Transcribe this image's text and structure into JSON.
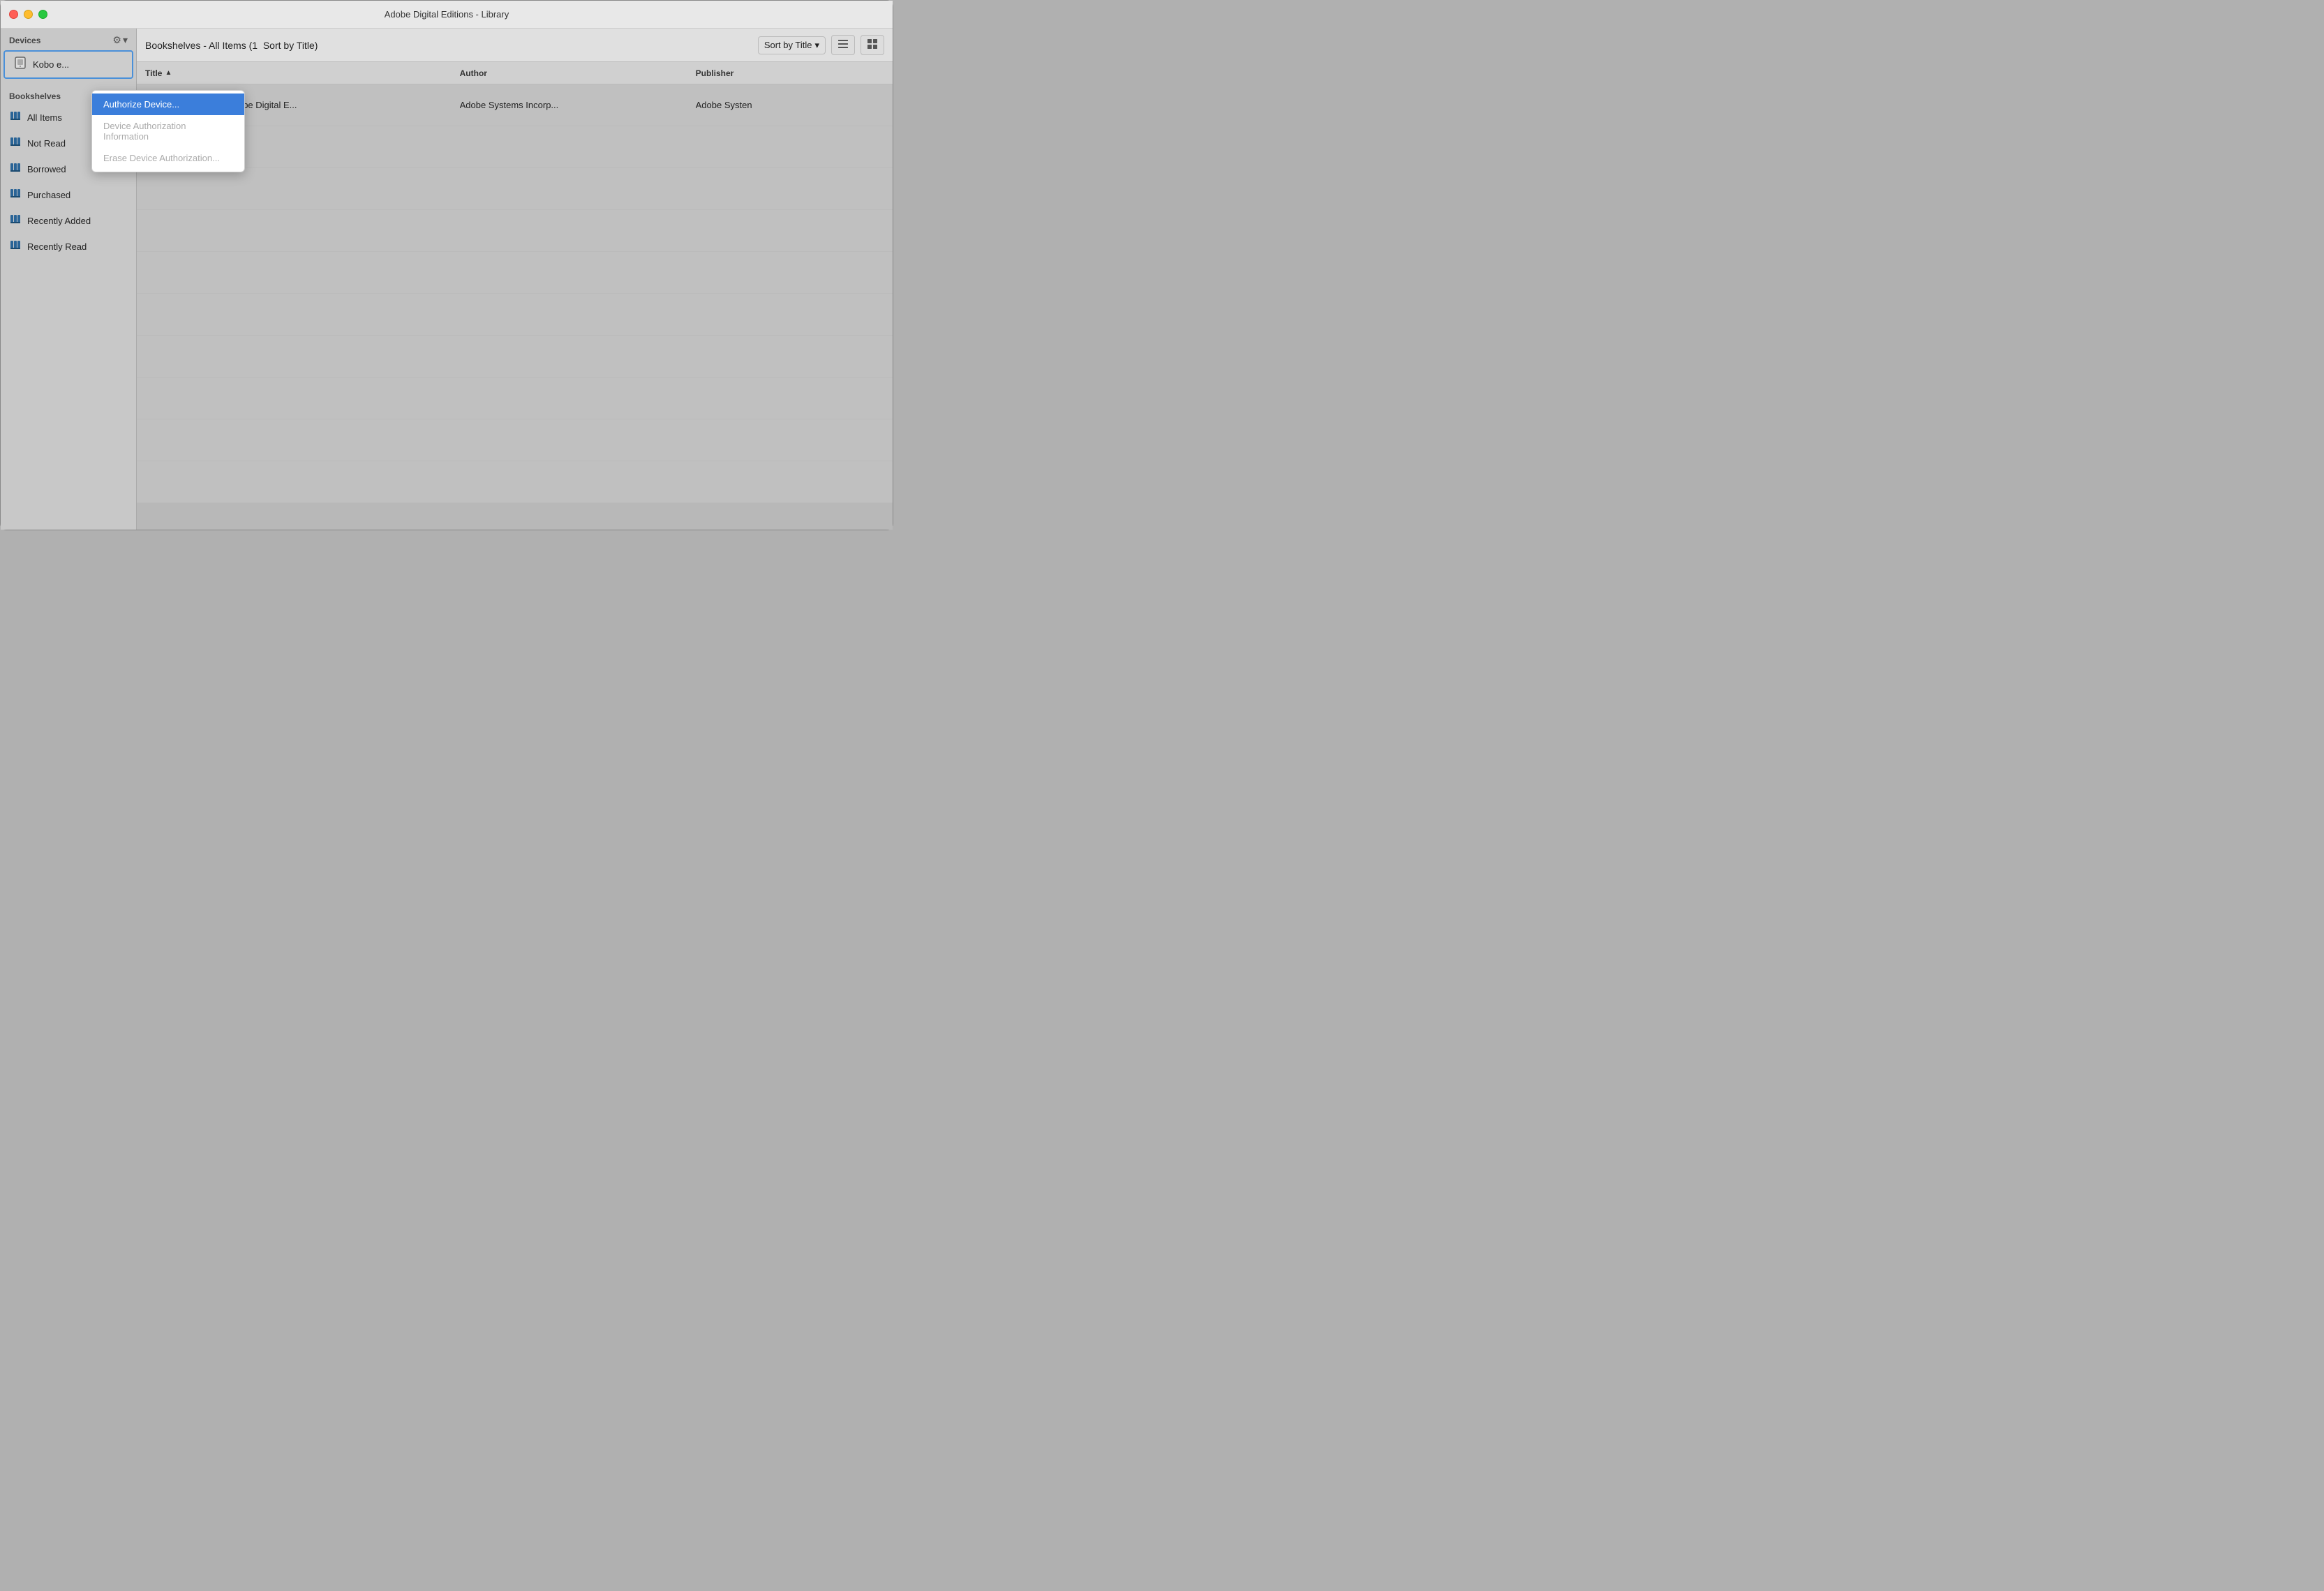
{
  "window": {
    "title": "Adobe Digital Editions - Library"
  },
  "sidebar": {
    "devices_label": "Devices",
    "gear_icon": "⚙",
    "gear_dropdown_icon": "▾",
    "device_name": "Kobo e...",
    "dropdown_menu": {
      "items": [
        {
          "id": "authorize",
          "label": "Authorize Device...",
          "state": "active"
        },
        {
          "id": "device-info",
          "label": "Device Authorization Information",
          "state": "disabled"
        },
        {
          "id": "erase",
          "label": "Erase Device Authorization...",
          "state": "disabled"
        }
      ]
    },
    "bookshelves_label": "Bookshelves",
    "add_icon": "+",
    "settings_icon": "⚙",
    "settings_dropdown_icon": "▾",
    "shelves": [
      {
        "id": "all-items",
        "label": "All Items"
      },
      {
        "id": "not-read",
        "label": "Not Read"
      },
      {
        "id": "borrowed",
        "label": "Borrowed"
      },
      {
        "id": "purchased",
        "label": "Purchased"
      },
      {
        "id": "recently-added",
        "label": "Recently Added"
      },
      {
        "id": "recently-read",
        "label": "Recently Read"
      }
    ]
  },
  "content": {
    "toolbar_title": "Bookshelves - All Items (1",
    "sort_label": "Sort by Title",
    "chevron_icon": "▾",
    "view_list_icon": "≡",
    "view_grid_icon": "⊞",
    "columns": {
      "title": "Title",
      "sort_arrow": "^",
      "author": "Author",
      "publisher": "Publisher"
    },
    "rows": [
      {
        "title": "Getting Started with Adobe Digital E...",
        "author": "Adobe Systems Incorp...",
        "publisher": "Adobe Systen"
      }
    ]
  }
}
